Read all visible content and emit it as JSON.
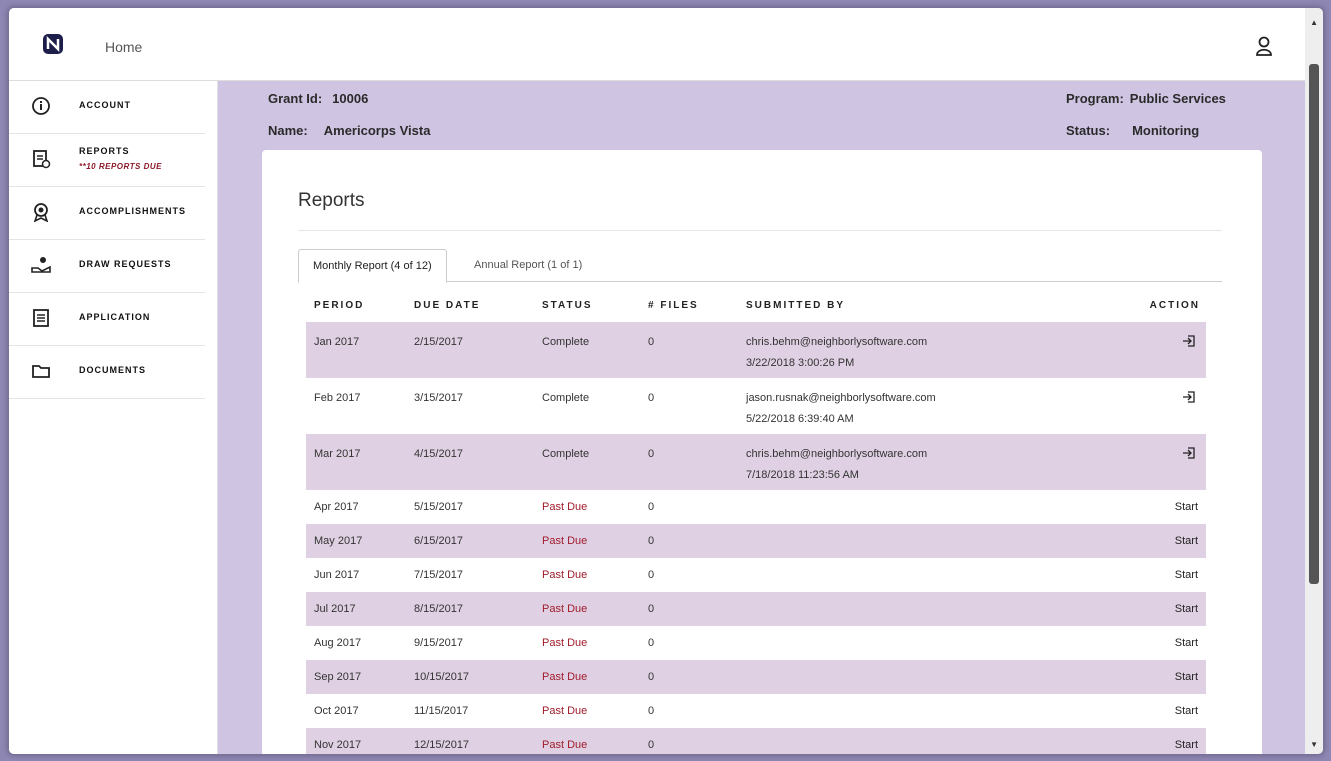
{
  "topbar": {
    "home_label": "Home"
  },
  "sidebar": {
    "items": [
      {
        "label": "ACCOUNT",
        "icon": "info-icon"
      },
      {
        "label": "REPORTS",
        "sub": "**10 REPORTS DUE",
        "icon": "report-icon"
      },
      {
        "label": "ACCOMPLISHMENTS",
        "icon": "award-icon"
      },
      {
        "label": "DRAW REQUESTS",
        "icon": "draw-request-icon"
      },
      {
        "label": "APPLICATION",
        "icon": "application-icon"
      },
      {
        "label": "DOCUMENTS",
        "icon": "folder-icon"
      }
    ]
  },
  "header": {
    "grant_id_label": "Grant Id:",
    "grant_id_value": "10006",
    "name_label": "Name:",
    "name_value": "Americorps Vista",
    "program_label": "Program:",
    "program_value": "Public Services",
    "status_label": "Status:",
    "status_value": "Monitoring"
  },
  "reports": {
    "title": "Reports",
    "tabs": [
      {
        "label": "Monthly Report (4 of 12)"
      },
      {
        "label": "Annual Report (1 of 1)"
      }
    ],
    "columns": [
      "PERIOD",
      "DUE DATE",
      "STATUS",
      "# FILES",
      "SUBMITTED BY",
      "ACTION"
    ],
    "rows": [
      {
        "period": "Jan 2017",
        "due": "2/15/2017",
        "status": "Complete",
        "files": "0",
        "by": "chris.behm@neighborlysoftware.com",
        "at": "3/22/2018 3:00:26 PM",
        "action": ""
      },
      {
        "period": "Feb 2017",
        "due": "3/15/2017",
        "status": "Complete",
        "files": "0",
        "by": "jason.rusnak@neighborlysoftware.com",
        "at": "5/22/2018 6:39:40 AM",
        "action": ""
      },
      {
        "period": "Mar 2017",
        "due": "4/15/2017",
        "status": "Complete",
        "files": "0",
        "by": "chris.behm@neighborlysoftware.com",
        "at": "7/18/2018 11:23:56 AM",
        "action": ""
      },
      {
        "period": "Apr 2017",
        "due": "5/15/2017",
        "status": "Past Due",
        "files": "0",
        "by": "",
        "at": "",
        "action": "Start"
      },
      {
        "period": "May 2017",
        "due": "6/15/2017",
        "status": "Past Due",
        "files": "0",
        "by": "",
        "at": "",
        "action": "Start"
      },
      {
        "period": "Jun 2017",
        "due": "7/15/2017",
        "status": "Past Due",
        "files": "0",
        "by": "",
        "at": "",
        "action": "Start"
      },
      {
        "period": "Jul 2017",
        "due": "8/15/2017",
        "status": "Past Due",
        "files": "0",
        "by": "",
        "at": "",
        "action": "Start"
      },
      {
        "period": "Aug 2017",
        "due": "9/15/2017",
        "status": "Past Due",
        "files": "0",
        "by": "",
        "at": "",
        "action": "Start"
      },
      {
        "period": "Sep 2017",
        "due": "10/15/2017",
        "status": "Past Due",
        "files": "0",
        "by": "",
        "at": "",
        "action": "Start"
      },
      {
        "period": "Oct 2017",
        "due": "11/15/2017",
        "status": "Past Due",
        "files": "0",
        "by": "",
        "at": "",
        "action": "Start"
      },
      {
        "period": "Nov 2017",
        "due": "12/15/2017",
        "status": "Past Due",
        "files": "0",
        "by": "",
        "at": "",
        "action": "Start"
      }
    ]
  },
  "colors": {
    "accent": "#8b1a2b",
    "background": "#cfc5e3",
    "row_shade": "#dfd1e3"
  }
}
